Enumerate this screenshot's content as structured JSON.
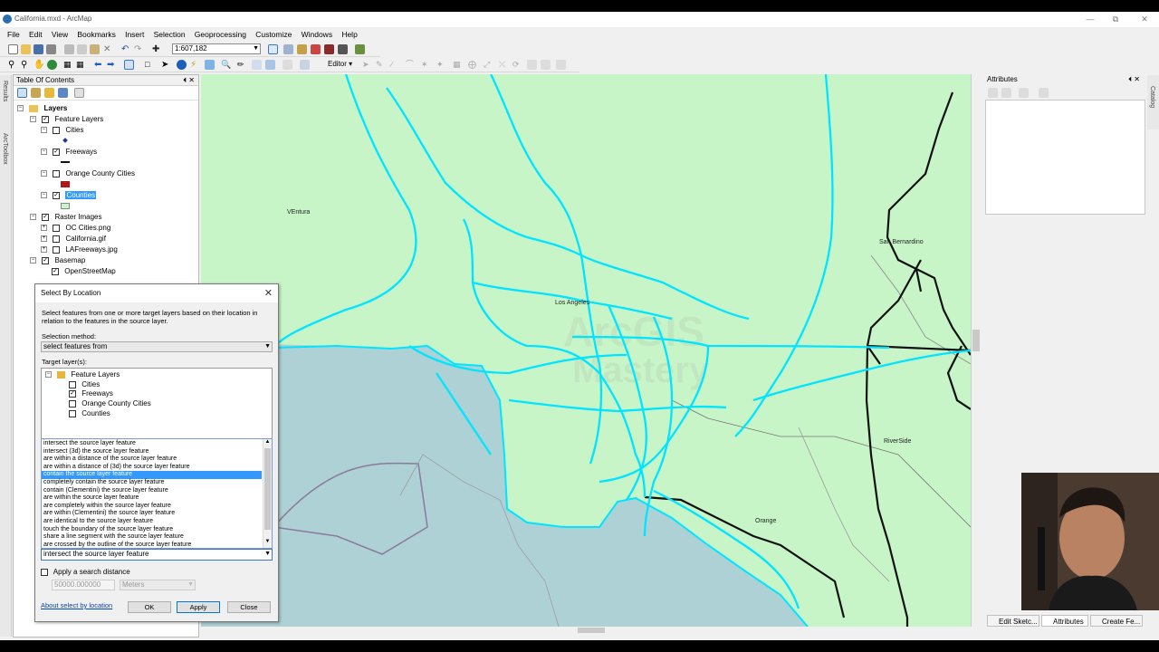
{
  "window": {
    "title": "California.mxd - ArcMap"
  },
  "menu": [
    "File",
    "Edit",
    "View",
    "Bookmarks",
    "Insert",
    "Selection",
    "Geoprocessing",
    "Customize",
    "Windows",
    "Help"
  ],
  "toolbar": {
    "scale": "1:607,182",
    "editor_label": "Editor ▾"
  },
  "side_strip": {
    "results": "Results",
    "arctoolbox": "ArcToolbox"
  },
  "right_strip": {
    "catalog": "Catalog"
  },
  "toc": {
    "title": "Table Of Contents",
    "root": "Layers",
    "feature_group": "Feature Layers",
    "layers": [
      "Cities",
      "Freeways",
      "Orange County Cities",
      "Counties"
    ],
    "raster_group": "Raster Images",
    "rasters": [
      "OC Cities.png",
      "California.gif",
      "LAFreeways.jpg"
    ],
    "basemap_group": "Basemap",
    "basemap_layer": "OpenStreetMap"
  },
  "map": {
    "labels": [
      "VEntura",
      "Los Angeles",
      "San Bernardino",
      "RiverSide",
      "Orange"
    ],
    "watermark": "ArcGIS Mastery",
    "colors": {
      "land": "#c8f5c8",
      "ocean": "#aed1d6",
      "freeway": "#00e5ff",
      "road": "#111111"
    }
  },
  "attributes": {
    "title": "Attributes"
  },
  "bottom_tabs": [
    "Edit Sketc...",
    "Attributes",
    "Create Fe..."
  ],
  "dialog": {
    "title": "Select By Location",
    "description": "Select features from one or more target layers based on their location in relation to the features in the source layer.",
    "method_label": "Selection method:",
    "method_value": "select features from",
    "target_label": "Target layer(s):",
    "target_group": "Feature Layers",
    "target_layers": [
      "Cities",
      "Freeways",
      "Orange County Cities",
      "Counties"
    ],
    "methods": [
      "intersect the source layer feature",
      "intersect (3d) the source layer feature",
      "are within a distance of the source layer feature",
      "are within a distance of (3d) the source layer feature",
      "contain the source layer feature",
      "completely contain the source layer feature",
      "contain (Clementini) the source layer feature",
      "are within the source layer feature",
      "are completely within the source layer feature",
      "are within (Clementini) the source layer feature",
      "are identical to the source layer feature",
      "touch the boundary of the source layer feature",
      "share a line segment with the source layer feature",
      "are crossed by the outline of the source layer feature"
    ],
    "selected_method_index": 4,
    "combo_value": "intersect the source layer feature",
    "search_distance_label": "Apply a search distance",
    "distance_value": "50000.000000",
    "unit_value": "Meters",
    "help_link": "About select by location",
    "ok": "OK",
    "apply": "Apply",
    "close": "Close"
  }
}
